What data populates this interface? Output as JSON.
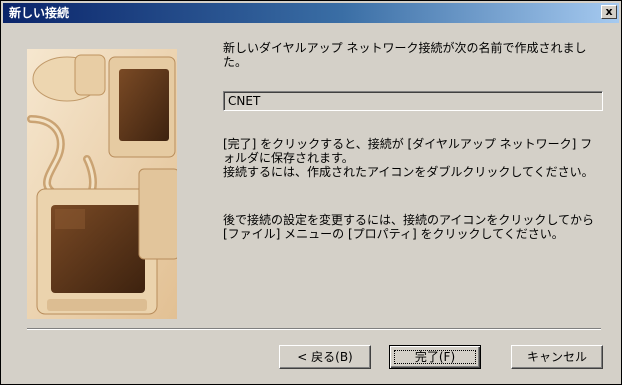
{
  "window": {
    "title": "新しい接続",
    "close_label": "x"
  },
  "content": {
    "intro": "新しいダイヤルアップ ネットワーク接続が次の名前で作成されました。",
    "connection_name": "CNET",
    "instruction_1": "[完了] をクリックすると、接続が [ダイヤルアップ ネットワーク] フォルダに保存されます。",
    "instruction_2": "接続するには、作成されたアイコンをダブルクリックしてください。",
    "instruction_3": "後で接続の設定を変更するには、接続のアイコンをクリックしてから [ファイル] メニューの [プロパティ] をクリックしてください。"
  },
  "buttons": {
    "back": "< 戻る(B)",
    "finish": "完了(F)",
    "cancel": "キャンセル"
  },
  "colors": {
    "titlebar_start": "#0a246a",
    "titlebar_end": "#a6caf0",
    "dialog_face": "#d4d0c8",
    "illustration_tint": "#c8935e"
  },
  "icons": {
    "illustration": "computer-monitors-illustration",
    "close": "close-icon"
  }
}
